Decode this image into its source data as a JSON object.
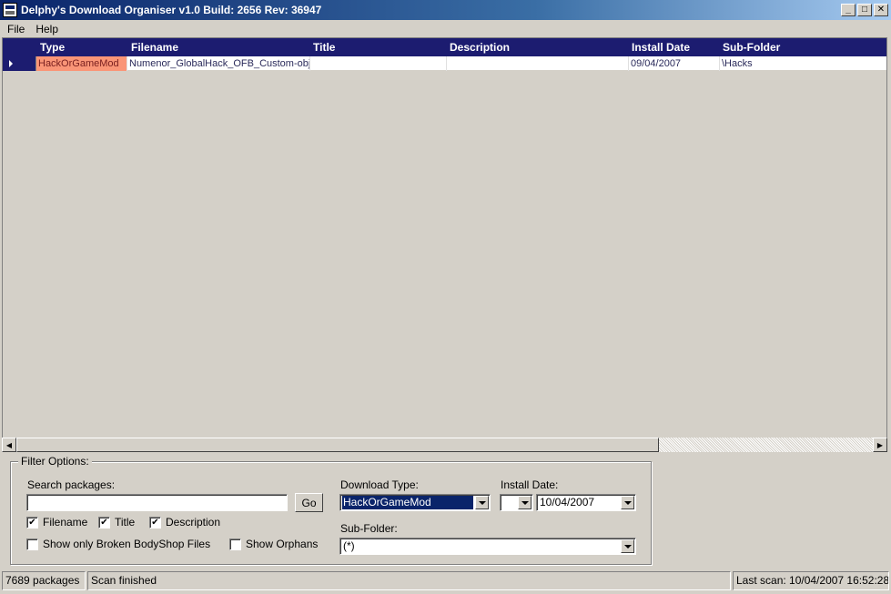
{
  "window": {
    "title": "Delphy's Download Organiser v1.0 Build: 2656 Rev: 36947",
    "minimize_glyph": "_",
    "maximize_glyph": "□",
    "close_glyph": "✕"
  },
  "menu": {
    "items": [
      "File",
      "Help"
    ]
  },
  "grid": {
    "columns": [
      "Type",
      "Filename",
      "Title",
      "Description",
      "Install Date",
      "Sub-Folder"
    ],
    "rows": [
      {
        "type": "HackOrGameMod",
        "filename": "Numenor_GlobalHack_OFB_Custom-obj",
        "title": "",
        "description": "",
        "install_date": "09/04/2007",
        "sub_folder": "\\Hacks"
      }
    ],
    "type_highlight_color": "#fa9577"
  },
  "filter": {
    "legend": "Filter Options:",
    "search_label": "Search packages:",
    "search_value": "",
    "go_label": "Go",
    "checkboxes": {
      "filename": {
        "label": "Filename",
        "checked": true
      },
      "title": {
        "label": "Title",
        "checked": true
      },
      "description": {
        "label": "Description",
        "checked": true
      },
      "broken_bodyshop": {
        "label": "Show only Broken BodyShop Files",
        "checked": false
      },
      "orphans": {
        "label": "Show Orphans",
        "checked": false
      }
    },
    "check_mark": "✔",
    "download_type_label": "Download Type:",
    "download_type_value": "HackOrGameMod",
    "install_date_label": "Install Date:",
    "install_date_operator": "",
    "install_date_value": "10/04/2007",
    "sub_folder_label": "Sub-Folder:",
    "sub_folder_value": "(*)"
  },
  "status": {
    "packages": "7689 packages",
    "message": "Scan finished",
    "last_scan": "Last scan: 10/04/2007 16:52:28"
  },
  "colors": {
    "title_bar": "#0a246a",
    "grid_header": "#1c1c70",
    "selection": "#0a246a"
  }
}
